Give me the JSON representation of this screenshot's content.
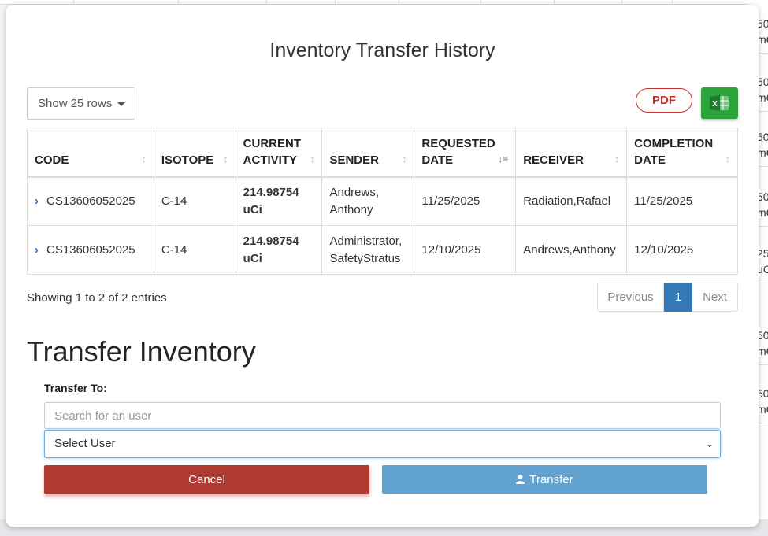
{
  "background": {
    "right_cells": [
      {
        "line1": "50",
        "line2": "mC"
      },
      {
        "line1": "50",
        "line2": "mC"
      },
      {
        "line1": "50",
        "line2": "mC"
      },
      {
        "line1": "50",
        "line2": "mC"
      },
      {
        "line1": "25",
        "line2": "uC"
      },
      {
        "line1": "50",
        "line2": "mC"
      },
      {
        "line1": "50",
        "line2": "mC"
      }
    ]
  },
  "modal": {
    "title": "Inventory Transfer History",
    "rows_selector": "Show 25 rows",
    "pdf_label": "PDF",
    "excel_icon": "excel-icon",
    "table": {
      "headers": [
        {
          "line1": "CODE",
          "line2": ""
        },
        {
          "line1": "ISOTOPE",
          "line2": ""
        },
        {
          "line1": "CURRENT",
          "line2": "ACTIVITY"
        },
        {
          "line1": "SENDER",
          "line2": ""
        },
        {
          "line1": "REQUESTED",
          "line2": "DATE"
        },
        {
          "line1": "RECEIVER",
          "line2": ""
        },
        {
          "line1": "COMPLETION",
          "line2": "DATE"
        }
      ],
      "rows": [
        {
          "code": "CS13606052025",
          "isotope": "C-14",
          "activity_value": "214.98754",
          "activity_unit": "uCi",
          "sender_line1": "Andrews,",
          "sender_line2": "Anthony",
          "requested": "11/25/2025",
          "receiver": "Radiation,Rafael",
          "completion": "11/25/2025"
        },
        {
          "code": "CS13606052025",
          "isotope": "C-14",
          "activity_value": "214.98754",
          "activity_unit": "uCi",
          "sender_line1": "Administrator,",
          "sender_line2": "SafetyStratus",
          "requested": "12/10/2025",
          "receiver": "Andrews,Anthony",
          "completion": "12/10/2025"
        }
      ]
    },
    "showing_text": "Showing 1 to 2 of 2 entries",
    "pager": {
      "previous": "Previous",
      "current": "1",
      "next": "Next"
    },
    "transfer_heading": "Transfer Inventory",
    "transfer_to_label": "Transfer To:",
    "search_placeholder": "Search for an user",
    "select_value": "Select User",
    "cancel_label": "Cancel",
    "transfer_label": "Transfer"
  }
}
